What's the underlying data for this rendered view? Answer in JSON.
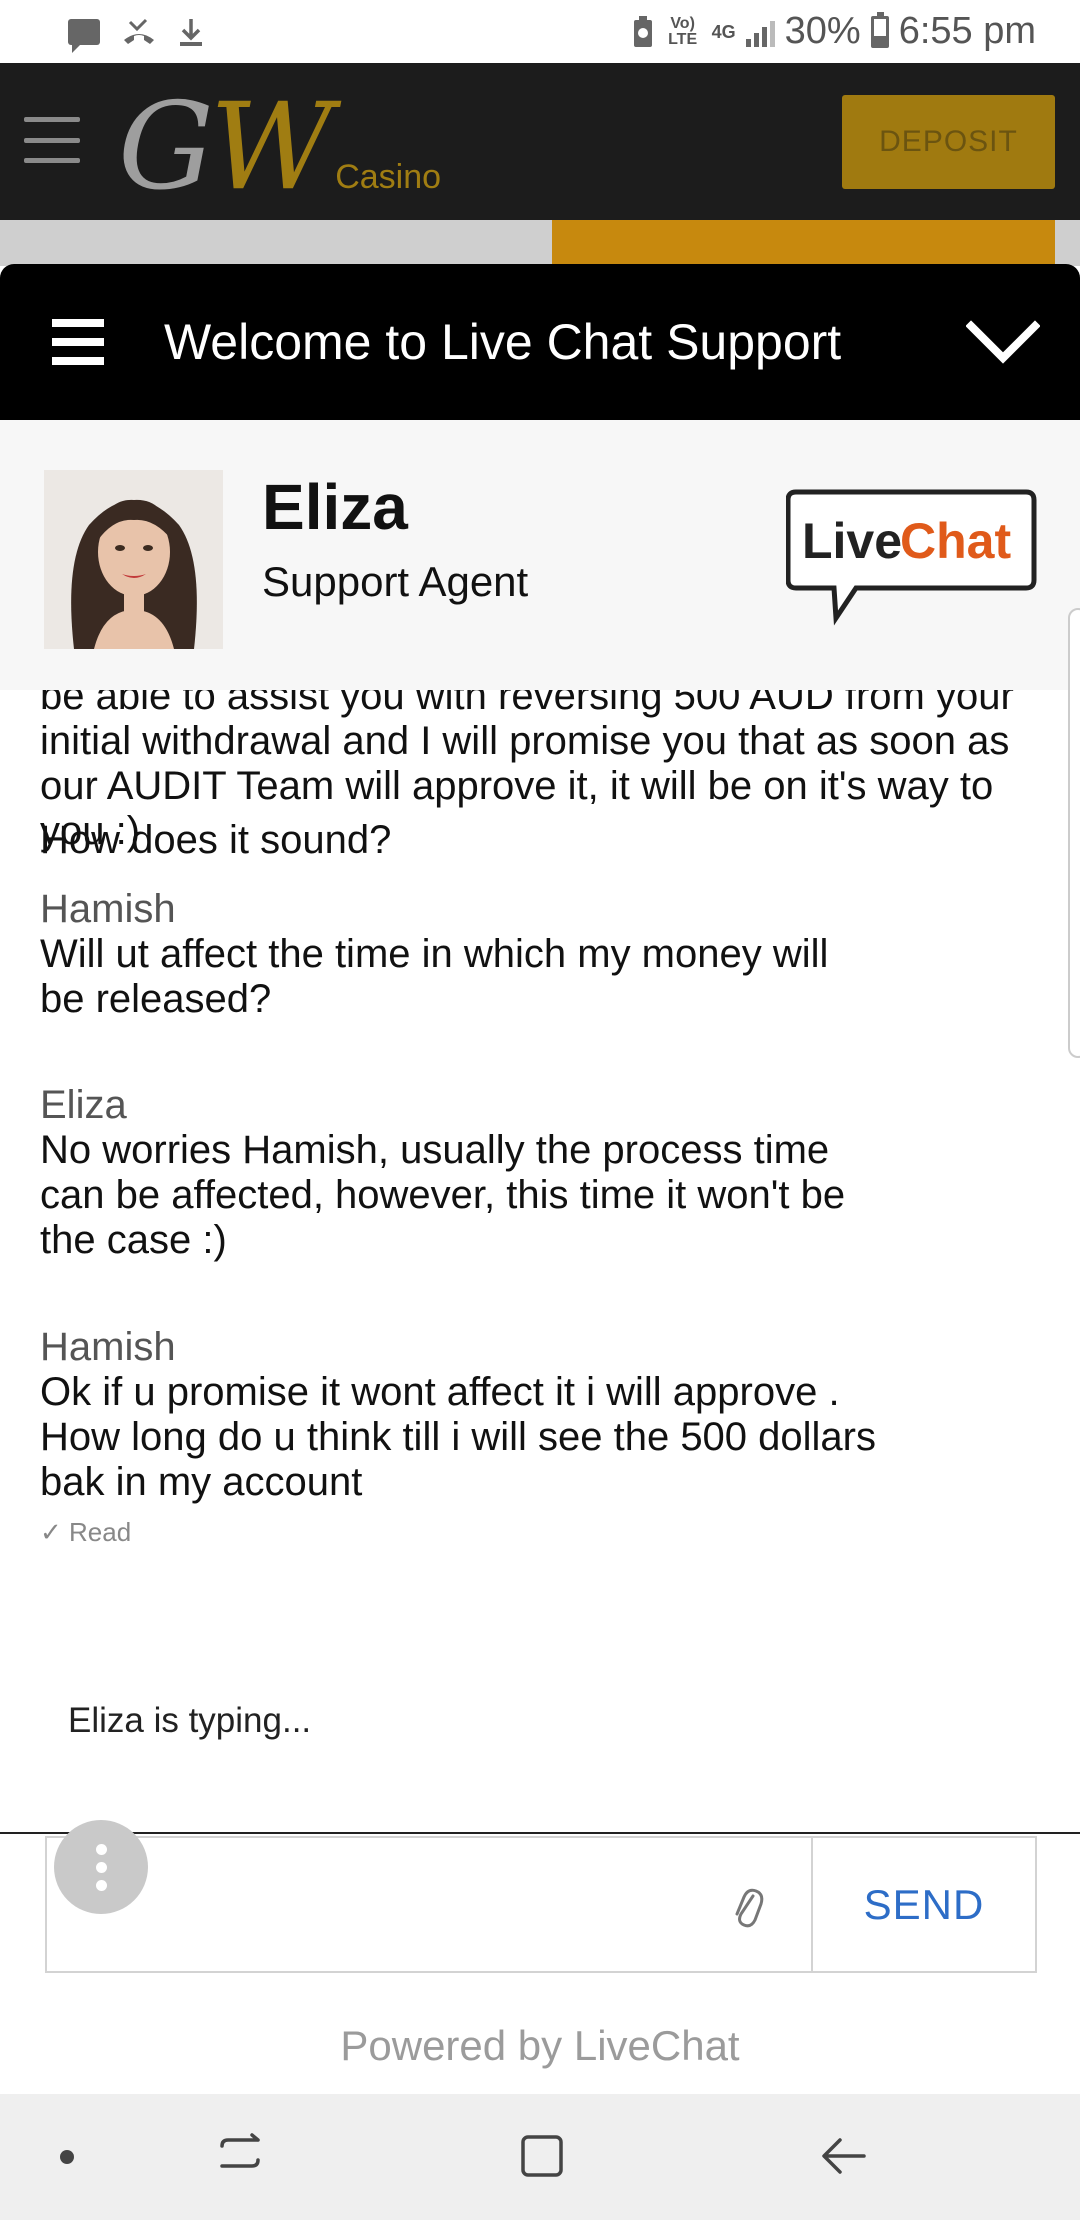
{
  "status_bar": {
    "network": "4G",
    "lte": "Vo) LTE",
    "battery": "30%",
    "time": "6:55 pm",
    "icons": [
      "message-icon",
      "missed-call-icon",
      "download-icon",
      "battery-saver-icon",
      "signal-icon",
      "battery-icon"
    ]
  },
  "app_header": {
    "logo_letters_1": "G",
    "logo_letters_2": "W",
    "logo_suffix": "Casino",
    "deposit_label": "DEPOSIT",
    "colors": {
      "header_bg": "#1c1c1c",
      "gold": "#a07d12"
    }
  },
  "chat": {
    "header_title": "Welcome to Live Chat Support",
    "agent": {
      "name": "Eliza",
      "role": "Support Agent"
    },
    "brand_logo_part1": "Live",
    "brand_logo_part2": "Chat",
    "messages": [
      {
        "lines": "be able to assist you with reversing 500 AUD from your initial withdrawal and I will promise you that as soon as our AUDIT Team will approve it, it will be on it's way to you :)"
      },
      {
        "text": "How does it sound?"
      },
      {
        "sender": "Hamish",
        "text": "Will ut affect the time in which my money will be released?"
      },
      {
        "sender": "Eliza",
        "text": "No worries Hamish, usually the process time can be affected, however, this time it won't be the case :)"
      },
      {
        "sender": "Hamish",
        "text": "Ok if u promise it wont affect it i will approve . How long do u think till i will see the 500 dollars bak in my account",
        "status": "Read"
      }
    ],
    "typing_indicator": "Eliza is typing...",
    "input": {
      "placeholder": "",
      "value": ""
    },
    "send_label": "SEND",
    "powered_by": "Powered by LiveChat",
    "colors": {
      "send": "#2d6dc7",
      "livechat_orange": "#e05a1a"
    }
  }
}
